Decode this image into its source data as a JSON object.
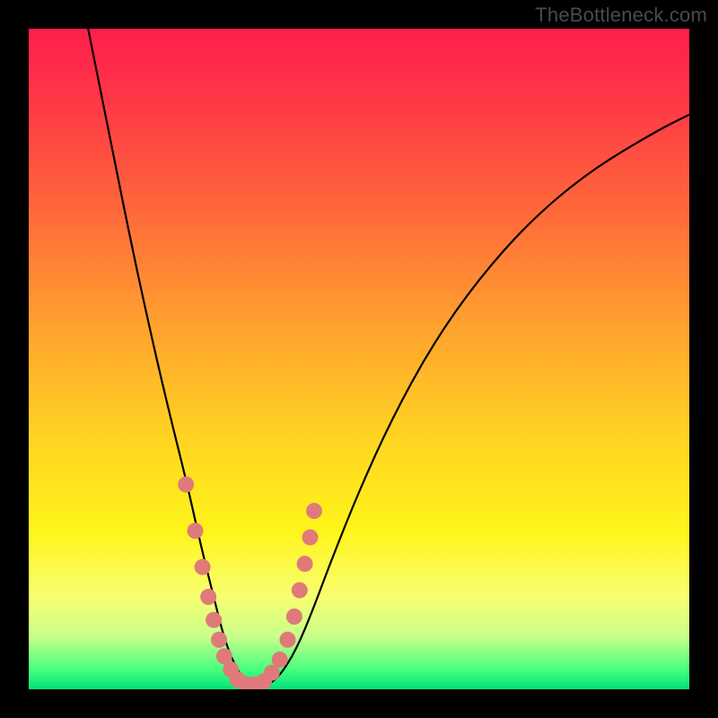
{
  "watermark": "TheBottleneck.com",
  "colors": {
    "background": "#000000",
    "gradient_top": "#ff1e4c",
    "gradient_bottom": "#00e27a",
    "curve": "#000000",
    "marker": "#e07a7a"
  },
  "chart_data": {
    "type": "line",
    "title": "",
    "xlabel": "",
    "ylabel": "",
    "xlim": [
      0,
      100
    ],
    "ylim": [
      0,
      100
    ],
    "series": [
      {
        "name": "bottleneck-curve",
        "x": [
          9,
          12,
          15,
          18,
          21,
          24,
          26,
          28,
          29.5,
          31,
          32.5,
          34,
          36,
          38,
          40.5,
          43,
          46,
          50,
          55,
          61,
          68,
          76,
          85,
          95,
          100
        ],
        "y": [
          100,
          85,
          70,
          56,
          43,
          31,
          22,
          14,
          8,
          4,
          1.5,
          0.5,
          0.5,
          2,
          6,
          12,
          20,
          30,
          41,
          52,
          62,
          71,
          78.5,
          84.5,
          87
        ]
      }
    ],
    "markers": {
      "name": "highlight-dots",
      "x": [
        23.8,
        25.2,
        26.3,
        27.2,
        28.0,
        28.8,
        29.6,
        30.6,
        31.6,
        32.8,
        34.2,
        35.6,
        36.8,
        38.0,
        39.2,
        40.2,
        41.0,
        41.8,
        42.6,
        43.2
      ],
      "y": [
        31,
        24,
        18.5,
        14,
        10.5,
        7.5,
        5,
        3,
        1.5,
        0.8,
        0.7,
        1.2,
        2.5,
        4.5,
        7.5,
        11,
        15,
        19,
        23,
        27
      ],
      "r": 9
    }
  }
}
